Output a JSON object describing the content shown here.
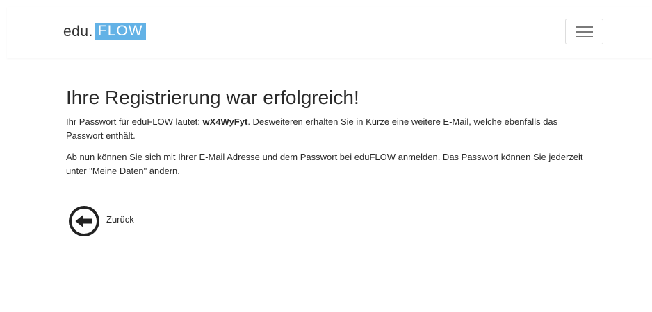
{
  "header": {
    "brand_part1": "edu.",
    "brand_part2": "FLOW",
    "menu_icon": "hamburger-menu-icon",
    "brand_accent": "#63b2e6"
  },
  "main": {
    "title": "Ihre Registrierung war erfolgreich!",
    "p1_before": "Ihr Passwort für eduFLOW lautet: ",
    "password": "wX4WyFyt",
    "p1_after": ". Desweiteren erhalten Sie in Kürze eine weitere E-Mail, welche ebenfalls das Passwort enthält.",
    "p2": "Ab nun können Sie sich mit Ihrer E-Mail Adresse und dem Passwort bei eduFLOW anmelden. Das Passwort können Sie jederzeit unter \"Meine Daten\" ändern.",
    "back_label": "Zurück",
    "back_icon": "arrow-left-circle-icon"
  }
}
